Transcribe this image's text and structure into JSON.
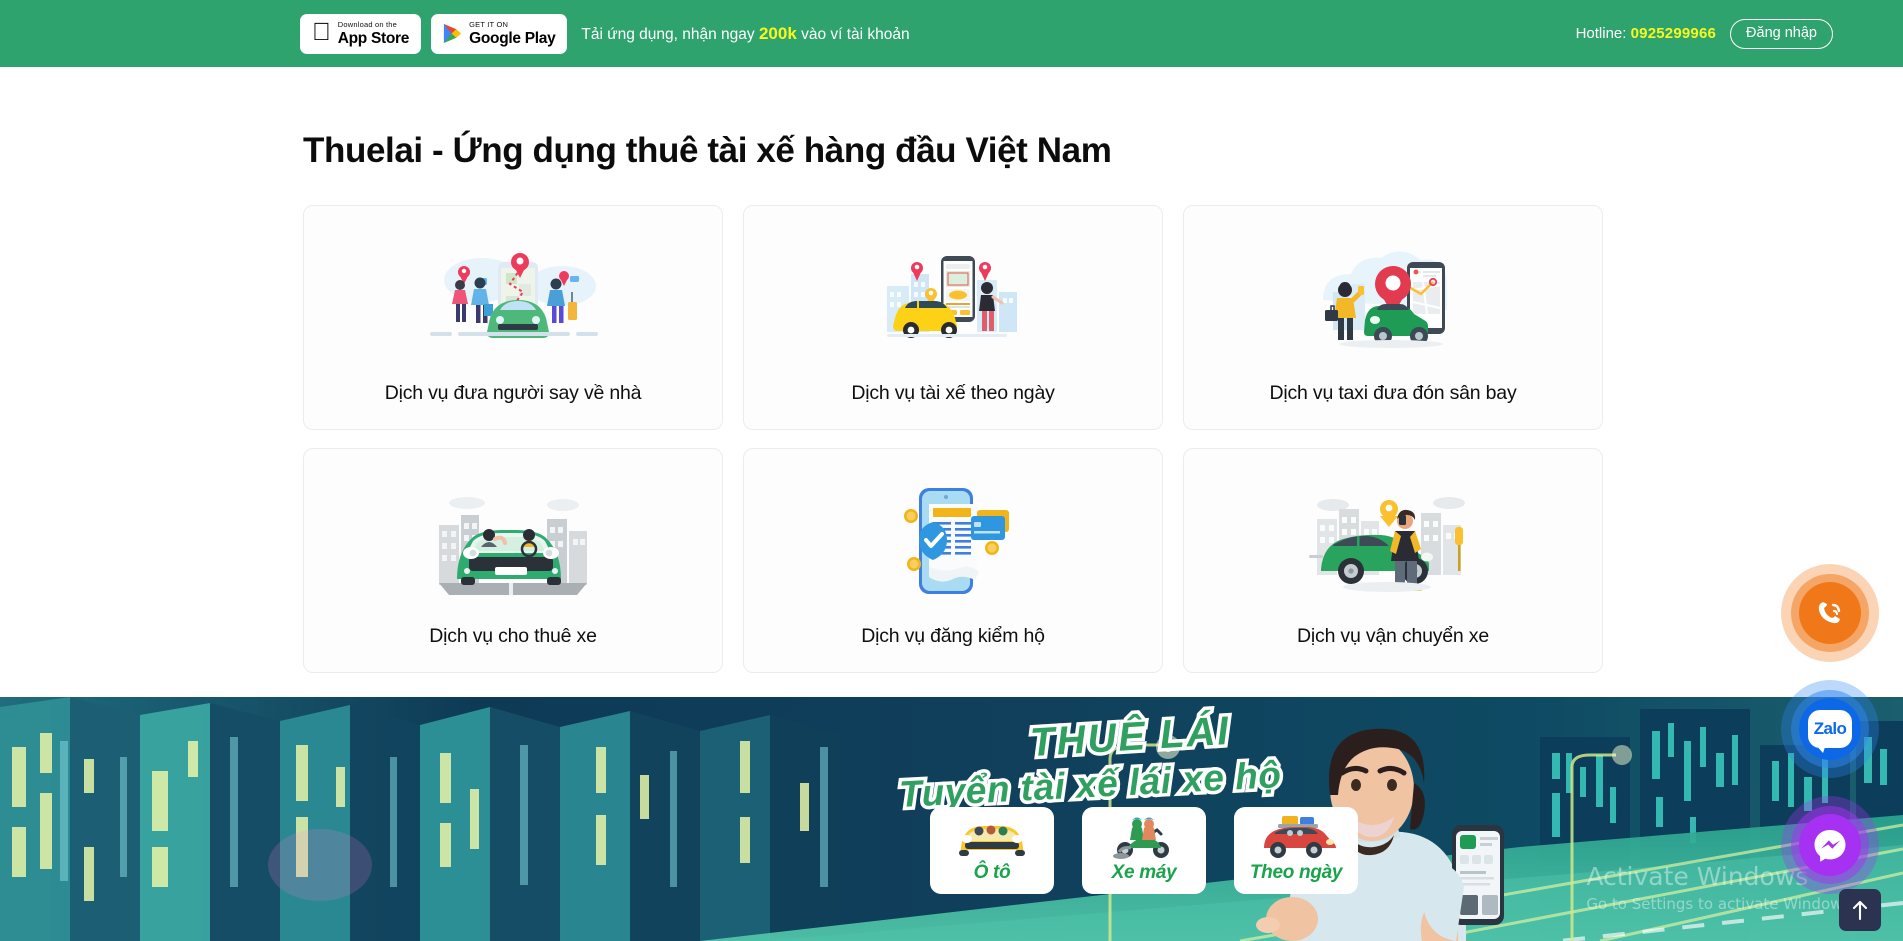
{
  "topbar": {
    "appstore": {
      "small": "Download on the",
      "big": "App Store",
      "icon": "apple-icon"
    },
    "googleplay": {
      "small": "GET IT ON",
      "big": "Google Play",
      "icon": "google-play-icon"
    },
    "promo_prefix": "Tải ứng dụng, nhận ngay ",
    "promo_highlight": "200k",
    "promo_suffix": " vào ví tài khoản",
    "hotline_label": "Hotline: ",
    "hotline_number": "0925299966",
    "login_label": "Đăng nhập"
  },
  "main": {
    "title": "Thuelai - Ứng dụng thuê tài xế hàng đầu Việt Nam",
    "cards": [
      {
        "label": "Dịch vụ đưa người say về nhà",
        "art": "drunk-ride-illustration"
      },
      {
        "label": "Dịch vụ tài xế theo ngày",
        "art": "daily-driver-illustration"
      },
      {
        "label": "Dịch vụ taxi đưa đón sân bay",
        "art": "airport-taxi-illustration"
      },
      {
        "label": "Dịch vụ cho thuê xe",
        "art": "car-rental-illustration"
      },
      {
        "label": "Dịch vụ đăng kiểm hộ",
        "art": "vehicle-inspection-illustration"
      },
      {
        "label": "Dịch vụ vận chuyển xe",
        "art": "car-transport-illustration"
      }
    ]
  },
  "banner": {
    "headline": "THUÊ LÁI",
    "subhead": "Tuyển tài xế lái xe hộ",
    "pills": [
      {
        "label": "Ô tô",
        "icon": "car-icon"
      },
      {
        "label": "Xe máy",
        "icon": "motorbike-icon"
      },
      {
        "label": "Theo ngày",
        "icon": "loaded-car-icon"
      }
    ]
  },
  "watermark": {
    "line1": "Activate Windows",
    "line2": "Go to Settings to activate Windows."
  },
  "fabs": [
    {
      "name": "phone",
      "label": "phone-call-icon",
      "color": "#f07818"
    },
    {
      "name": "zalo",
      "label": "Zalo",
      "color": "#0d68e8"
    },
    {
      "name": "messenger",
      "label": "messenger-icon",
      "color": "#a631f2"
    }
  ],
  "scrolltop": {
    "icon": "arrow-up-icon"
  },
  "colors": {
    "brand_green": "#2fa36e",
    "accent_yellow": "#f6f81f",
    "banner_green": "#19a34a"
  }
}
